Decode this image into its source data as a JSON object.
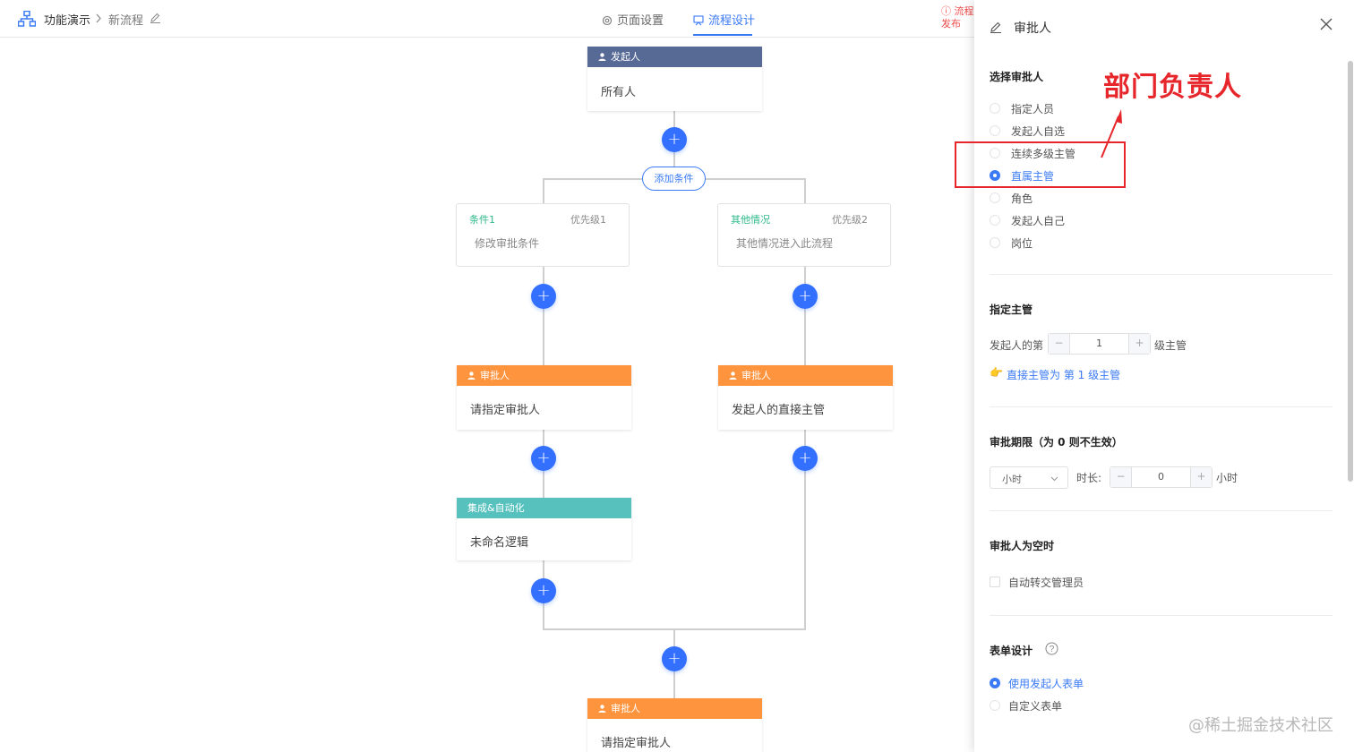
{
  "header": {
    "breadcrumb_root": "功能演示",
    "breadcrumb_current": "新流程",
    "tabs": [
      "页面设置",
      "流程设计"
    ],
    "active_tab": "流程设计",
    "publish_line1": "流程",
    "publish_line2": "发布",
    "icons": [
      "org-chart-icon",
      "chevron-right-icon",
      "edit-icon",
      "gear-icon",
      "flow-icon",
      "alert-icon"
    ]
  },
  "canvas": {
    "start_node": {
      "title": "发起人",
      "content": "所有人"
    },
    "add_condition_label": "添加条件",
    "branches": [
      {
        "title": "条件1",
        "priority": "优先级1",
        "content": "修改审批条件"
      },
      {
        "title": "其他情况",
        "priority": "优先级2",
        "content": "其他情况进入此流程"
      }
    ],
    "left_approver": {
      "title": "审批人",
      "content": "请指定审批人"
    },
    "right_approver": {
      "title": "审批人",
      "content": "发起人的直接主管"
    },
    "automation_node": {
      "title": "集成&自动化",
      "content": "未命名逻辑"
    },
    "bottom_approver": {
      "title": "审批人",
      "content": "请指定审批人"
    },
    "add_symbol": "+"
  },
  "panel": {
    "title": "审批人",
    "section_select": "选择审批人",
    "approver_options": [
      "指定人员",
      "发起人自选",
      "连续多级主管",
      "直属主管",
      "角色",
      "发起人自己",
      "岗位"
    ],
    "selected_option": "直属主管",
    "section_supervisor": "指定主管",
    "supervisor_prefix": "发起人的第",
    "supervisor_level": "1",
    "supervisor_suffix": "级主管",
    "supervisor_hint": "直接主管为 第 1 级主管",
    "section_deadline": "审批期限（为 0 则不生效）",
    "deadline_unit": "小时",
    "deadline_duration_label": "时长:",
    "deadline_value": "0",
    "deadline_suffix": "小时",
    "section_empty": "审批人为空时",
    "auto_transfer_label": "自动转交管理员",
    "section_form": "表单设计",
    "form_options": [
      "使用发起人表单",
      "自定义表单"
    ],
    "selected_form": "使用发起人表单",
    "stepper_minus": "−",
    "stepper_plus": "+"
  },
  "annotation": {
    "text": "部门负责人",
    "color": "#e7262b"
  },
  "watermark": "@稀土掘金技术社区",
  "colors": {
    "primary": "#3a7af5",
    "start": "#576a95",
    "approver": "#ff943e",
    "automation": "#57c1bd",
    "condition": "#2fb98a"
  }
}
